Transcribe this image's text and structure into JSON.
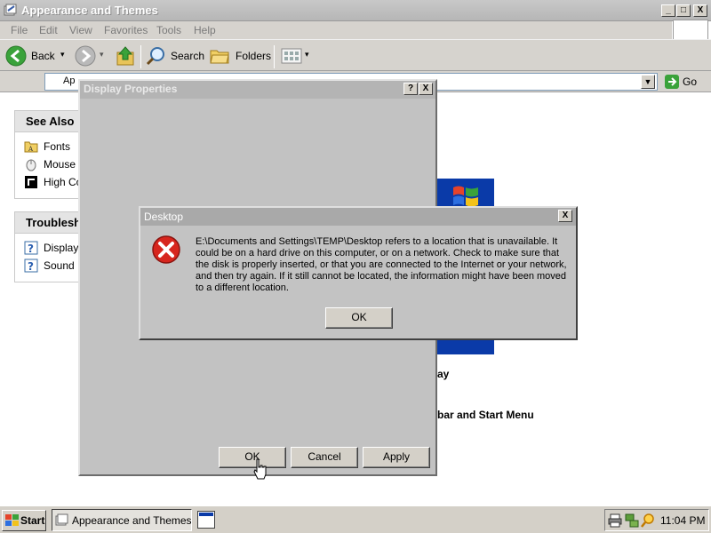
{
  "explorer": {
    "title": "Appearance and Themes",
    "controls": {
      "minimize": "_",
      "maximize": "□",
      "close": "X"
    },
    "menu": [
      "File",
      "Edit",
      "View",
      "Favorites",
      "Tools",
      "Help"
    ],
    "toolbar": {
      "back_label": "Back",
      "search_label": "Search",
      "folders_label": "Folders"
    },
    "address": {
      "partial_label": "Ap",
      "go_label": "Go"
    },
    "see_also": {
      "title": "See Also",
      "items": [
        {
          "label": "Fonts",
          "icon": "fonts-folder-icon"
        },
        {
          "label": "Mouse",
          "icon": "mouse-icon"
        },
        {
          "label": "High Co",
          "icon": "high-contrast-icon"
        }
      ]
    },
    "troubleshooters": {
      "title": "Troublesho",
      "items": [
        {
          "label": "Display",
          "icon": "help-icon"
        },
        {
          "label": "Sound",
          "icon": "help-icon"
        }
      ]
    },
    "main": {
      "partial_text_1": "ay",
      "partial_text_2": "bar and Start Menu"
    }
  },
  "display_properties": {
    "title": "Display Properties",
    "help": "?",
    "close": "X",
    "ok_label": "OK",
    "cancel_label": "Cancel",
    "apply_label": "Apply"
  },
  "error_dialog": {
    "title": "Desktop",
    "close": "X",
    "message": "E:\\Documents and Settings\\TEMP\\Desktop refers to a location that is unavailable. It could be on a hard drive on this computer, or on a network. Check to make sure that the disk is properly inserted, or that you are connected to the Internet or your network, and then try again. If it still cannot be located, the information might have been moved to a different location.",
    "ok_label": "OK",
    "icon": "error-x-icon"
  },
  "taskbar": {
    "start_label": "Start",
    "task_label": "Appearance and Themes",
    "clock": "11:04 PM"
  },
  "colors": {
    "error_red": "#d7261e",
    "xp_blue": "#0a3aa8",
    "go_green": "#3aa23a"
  }
}
